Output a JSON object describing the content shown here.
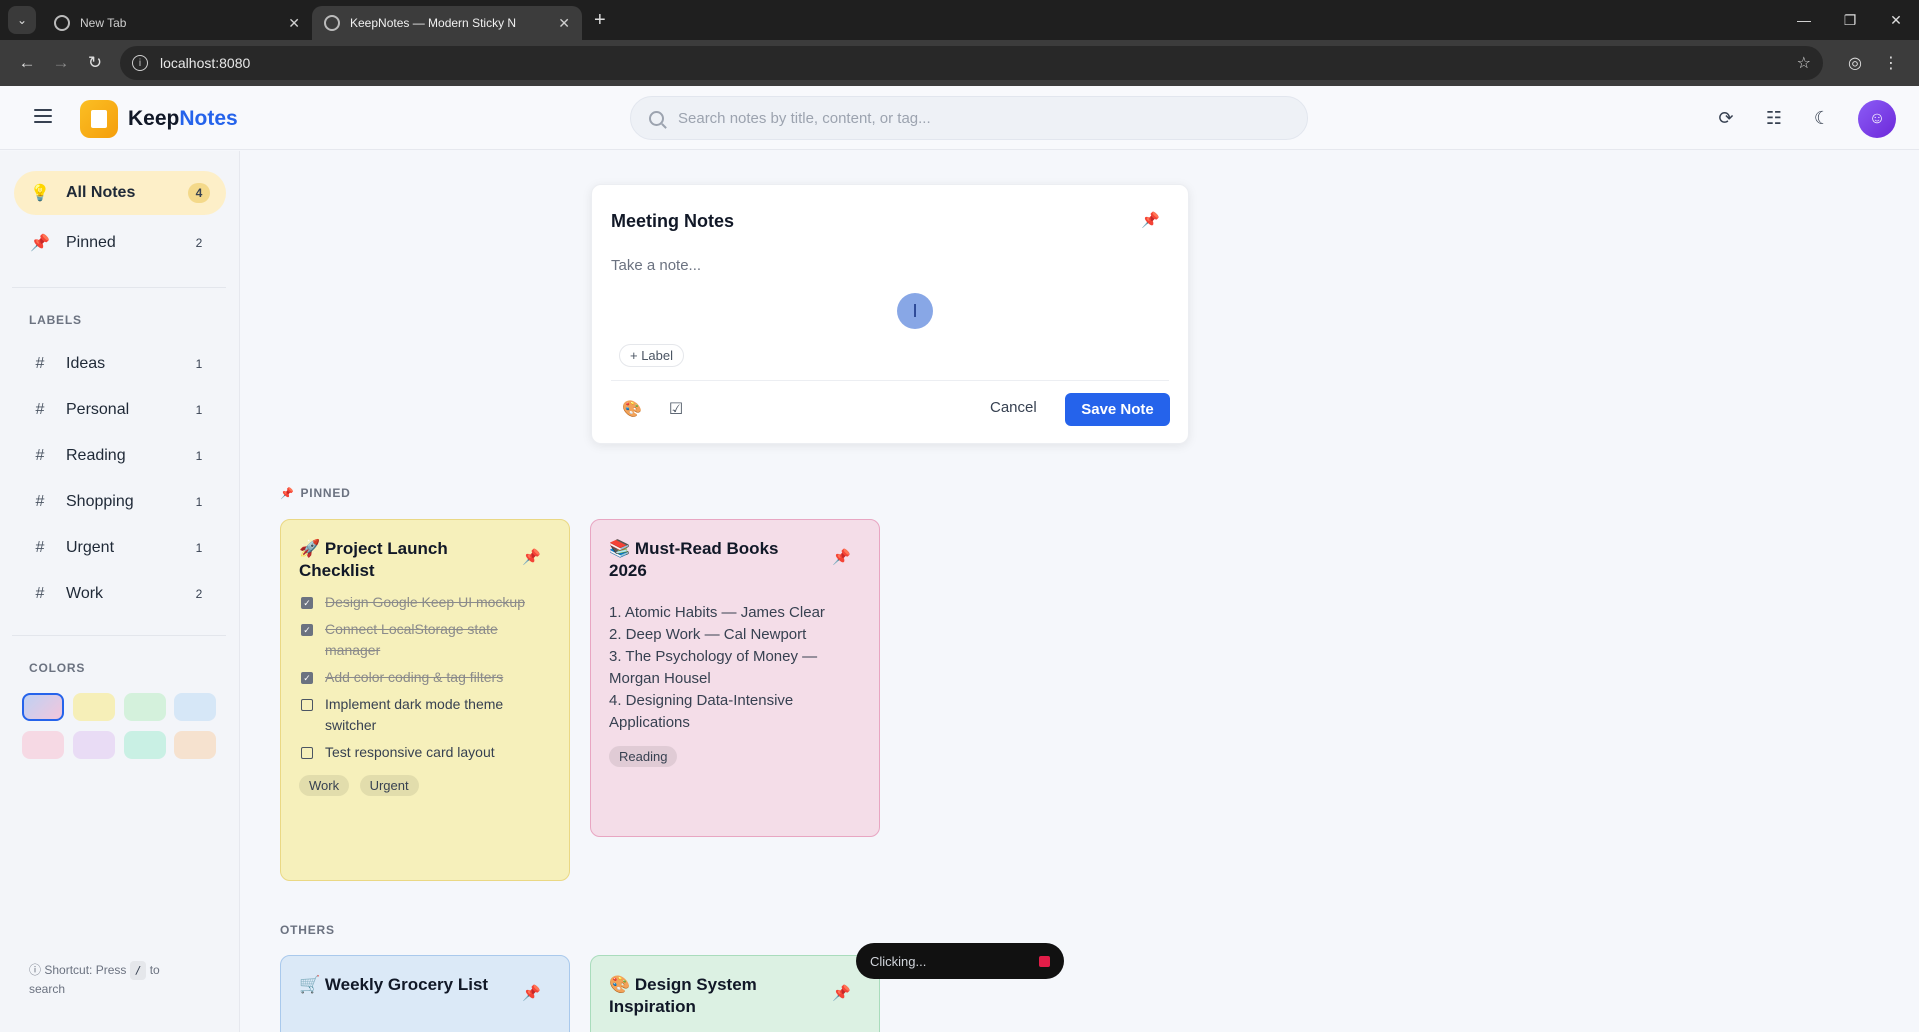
{
  "browser": {
    "tabs": [
      {
        "title": "New Tab",
        "active": false
      },
      {
        "title": "KeepNotes — Modern Sticky N",
        "active": true
      }
    ],
    "url": "localhost:8080"
  },
  "header": {
    "brand_primary": "Keep",
    "brand_accent": "Notes",
    "search_placeholder": "Search notes by title, content, or tag..."
  },
  "sidebar": {
    "nav": [
      {
        "label": "All Notes",
        "count": "4",
        "icon": "lightbulb-icon"
      },
      {
        "label": "Pinned",
        "count": "2",
        "icon": "pin-icon"
      }
    ],
    "labels_heading": "LABELS",
    "labels": [
      {
        "label": "Ideas",
        "count": "1"
      },
      {
        "label": "Personal",
        "count": "1"
      },
      {
        "label": "Reading",
        "count": "1"
      },
      {
        "label": "Shopping",
        "count": "1"
      },
      {
        "label": "Urgent",
        "count": "1"
      },
      {
        "label": "Work",
        "count": "2"
      }
    ],
    "colors_heading": "COLORS",
    "colors": [
      "#cfd8f0",
      "#f6efb8",
      "#d4f1dc",
      "#d6e7f7",
      "#f6d9e4",
      "#e9dcf5",
      "#c9f0e4",
      "#f6e2cf"
    ],
    "shortcut_prefix": "Shortcut: Press",
    "shortcut_key": "/",
    "shortcut_suffix": "to search"
  },
  "composer": {
    "title": "Meeting Notes",
    "body_placeholder": "Take a note...",
    "label_button": "+ Label",
    "cancel": "Cancel",
    "save": "Save Note"
  },
  "sections": {
    "pinned": "PINNED",
    "others": "OTHERS"
  },
  "notes": {
    "project": {
      "emoji": "🚀",
      "title": "Project Launch Checklist",
      "items": [
        {
          "text": "Design Google Keep UI mockup",
          "done": true
        },
        {
          "text": "Connect LocalStorage state manager",
          "done": true
        },
        {
          "text": "Add color coding & tag filters",
          "done": true
        },
        {
          "text": "Implement dark mode theme switcher",
          "done": false
        },
        {
          "text": "Test responsive card layout",
          "done": false
        }
      ],
      "tags": [
        "Work",
        "Urgent"
      ]
    },
    "books": {
      "emoji": "📚",
      "title": "Must-Read Books 2026",
      "lines": [
        "1. Atomic Habits — James Clear",
        "2. Deep Work — Cal Newport",
        "3. The Psychology of Money — Morgan Housel",
        "4. Designing Data-Intensive Applications"
      ],
      "tags": [
        "Reading"
      ]
    },
    "grocery": {
      "emoji": "🛒",
      "title": "Weekly Grocery List"
    },
    "design": {
      "emoji": "🎨",
      "title": "Design System Inspiration"
    }
  },
  "toast": "Clicking..."
}
